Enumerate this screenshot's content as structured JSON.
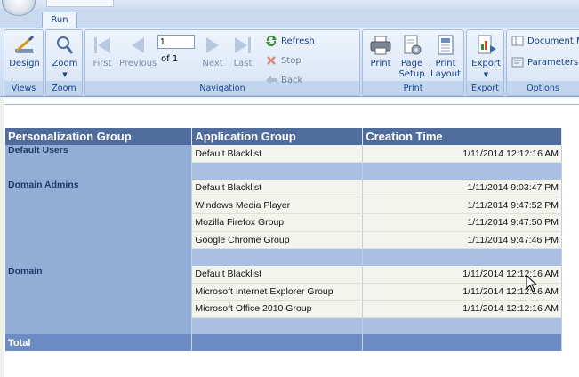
{
  "ribbon": {
    "tab_run": "Run",
    "groups": {
      "views": "Views",
      "zoom": "Zoom",
      "navigation": "Navigation",
      "print": "Print",
      "export": "Export",
      "options": "Options"
    },
    "buttons": {
      "design": "Design",
      "zoom": "Zoom",
      "first": "First",
      "previous": "Previous",
      "next": "Next",
      "last": "Last",
      "refresh": "Refresh",
      "stop": "Stop",
      "back": "Back",
      "print": "Print",
      "page_setup_1": "Page",
      "page_setup_2": "Setup",
      "print_layout_1": "Print",
      "print_layout_2": "Layout",
      "export": "Export",
      "document_map": "Document Ma",
      "parameters": "Parameters"
    },
    "page_number": "1",
    "of_pages": "of  1"
  },
  "report": {
    "headers": [
      "Personalization Group",
      "Application Group",
      "Creation Time"
    ],
    "groups": [
      {
        "name": "Default Users",
        "rows": [
          {
            "app": "Default Blacklist",
            "time": "1/11/2014 12:12:16 AM"
          }
        ]
      },
      {
        "name": "Domain Admins",
        "rows": [
          {
            "app": "Default Blacklist",
            "time": "1/11/2014 9:03:47 PM"
          },
          {
            "app": "Windows Media Player",
            "time": "1/11/2014 9:47:52 PM"
          },
          {
            "app": "Mozilla Firefox Group",
            "time": "1/11/2014 9:47:50 PM"
          },
          {
            "app": "Google Chrome Group",
            "time": "1/11/2014 9:47:46 PM"
          }
        ]
      },
      {
        "name": "Domain",
        "rows": [
          {
            "app": "Default Blacklist",
            "time": "1/11/2014 12:12:16 AM"
          },
          {
            "app": "Microsoft Internet Explorer Group",
            "time": "1/11/2014 12:12:16 AM"
          },
          {
            "app": "Microsoft Office 2010 Group",
            "time": "1/11/2014 12:12:16 AM"
          }
        ]
      }
    ],
    "total_label": "Total"
  }
}
